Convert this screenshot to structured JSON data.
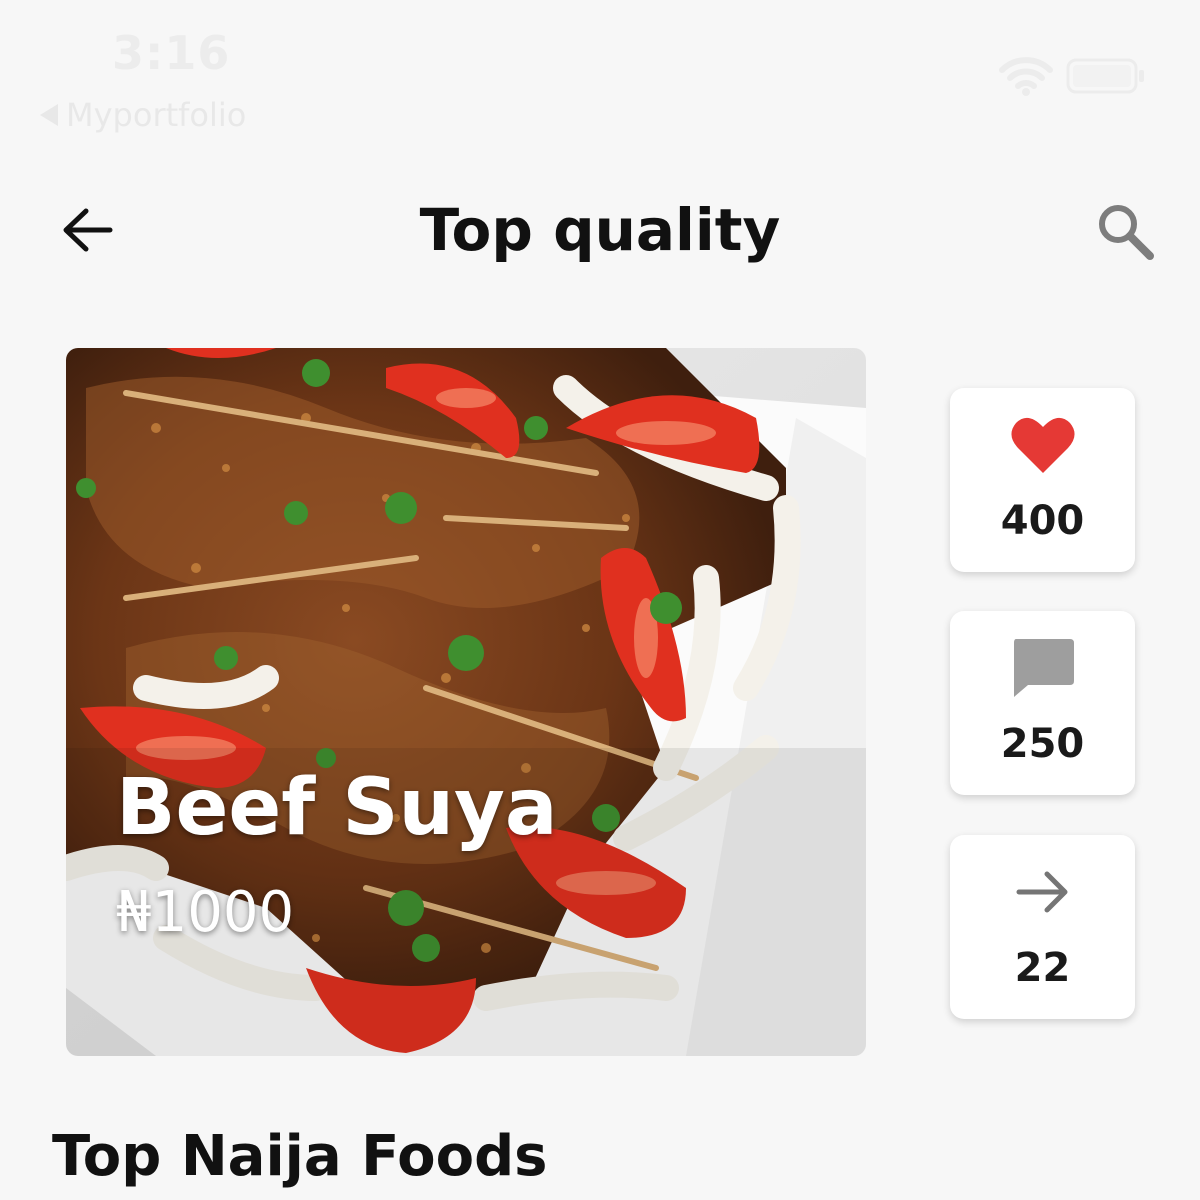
{
  "status_bar": {
    "time": "3:16",
    "back_label": "Myportfolio"
  },
  "header": {
    "title": "Top quality",
    "back_icon": "arrow-left-icon",
    "search_icon": "search-icon"
  },
  "featured": {
    "name": "Beef Suya",
    "price": "₦1000"
  },
  "stats": {
    "likes": {
      "icon": "heart-icon",
      "count": "400",
      "color": "#e53935"
    },
    "comments": {
      "icon": "comment-icon",
      "count": "250",
      "color": "#9e9e9e"
    },
    "shares": {
      "icon": "arrow-right-icon",
      "count": "22",
      "color": "#757575"
    }
  },
  "section": {
    "title": "Top Naija Foods"
  }
}
